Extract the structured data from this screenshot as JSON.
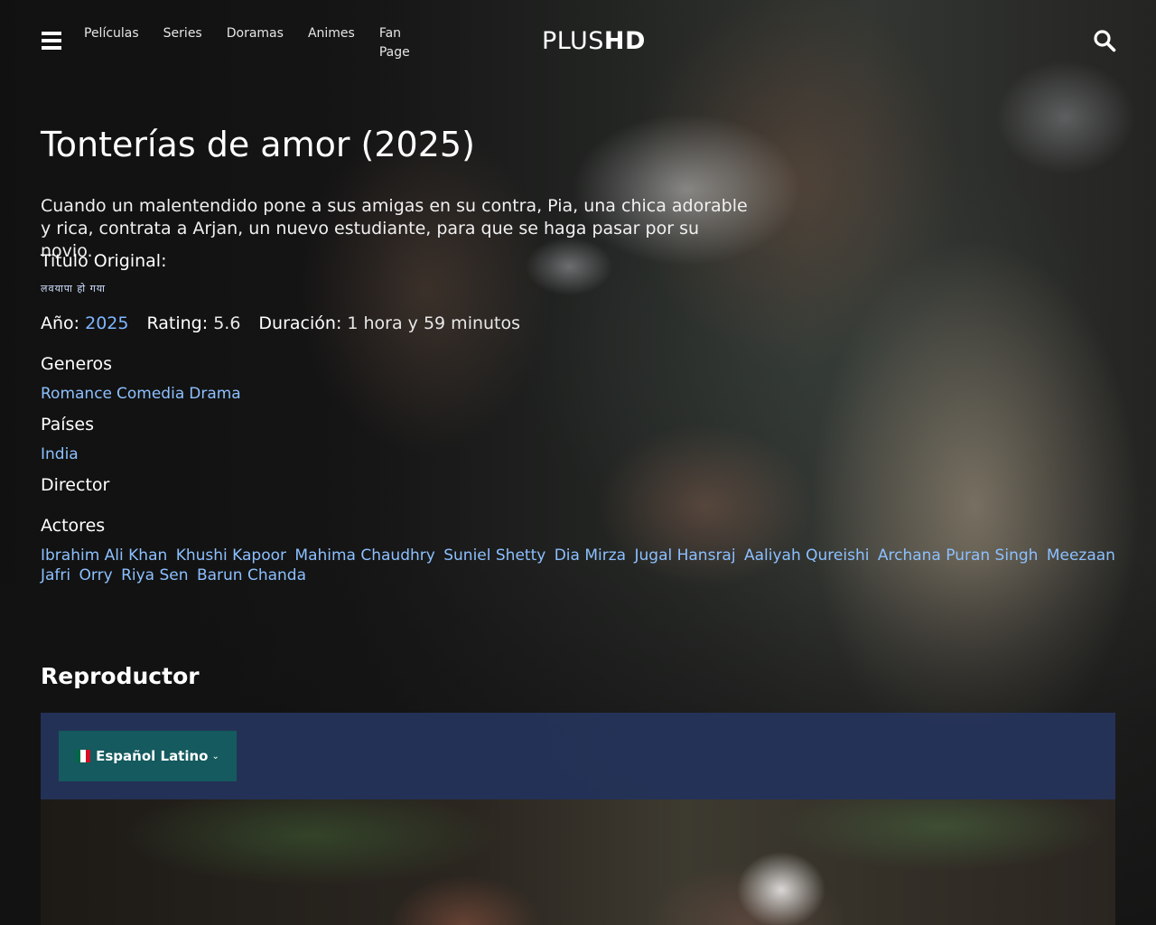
{
  "header": {
    "nav": [
      "Películas",
      "Series",
      "Doramas",
      "Animes",
      "Fan Page"
    ],
    "logo_plus": "PLUS",
    "logo_hd": "HD"
  },
  "movie": {
    "title": "Tonterías de amor (2025)",
    "synopsis": "Cuando un malentendido pone a sus amigas en su contra, Pia, una chica adorable y rica, contrata a Arjan, un nuevo estudiante, para que se haga pasar por su novio.",
    "original_title_label": "Titulo Original:",
    "original_title": "लवयापा हो गया",
    "year_label": "Año:",
    "year": "2025",
    "rating_label": "Rating:",
    "rating": "5.6",
    "duration_label": "Duración:",
    "duration": "1 hora y 59 minutos",
    "genres_label": "Generos",
    "genres": [
      "Romance",
      "Comedia",
      "Drama"
    ],
    "countries_label": "Países",
    "countries": [
      "India"
    ],
    "director_label": "Director",
    "actors_label": "Actores",
    "actors": [
      "Ibrahim Ali Khan",
      "Khushi Kapoor",
      "Mahima Chaudhry",
      "Suniel Shetty",
      "Dia Mirza",
      "Jugal Hansraj",
      "Aaliyah Qureishi",
      "Archana Puran Singh",
      "Meezaan Jafri",
      "Orry",
      "Riya Sen",
      "Barun Chanda"
    ]
  },
  "player": {
    "heading": "Reproductor",
    "language_label": "Español Latino"
  },
  "colors": {
    "link": "#8cc0ff",
    "player_bar": "#26345c",
    "language_button": "#145a5e"
  }
}
